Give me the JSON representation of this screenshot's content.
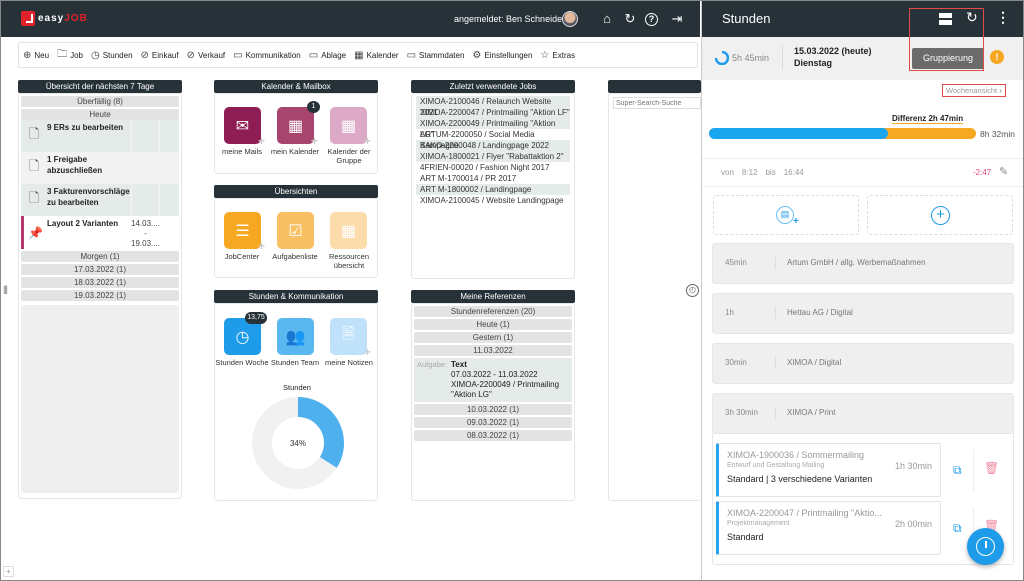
{
  "app": {
    "logo_left": "easy",
    "logo_right": "JOB",
    "logged_in": "angemeldet: Ben Schneider"
  },
  "top_icons": [
    "home-icon",
    "refresh-icon",
    "help-icon",
    "logout-icon"
  ],
  "toolbar": [
    {
      "label": "Neu",
      "icon": "⊕"
    },
    {
      "label": "Job",
      "icon": "🗀"
    },
    {
      "label": "Stunden",
      "icon": "◷"
    },
    {
      "label": "Einkauf",
      "icon": "⊘"
    },
    {
      "label": "Verkauf",
      "icon": "⊘"
    },
    {
      "label": "Kommunikation",
      "icon": "▭"
    },
    {
      "label": "Ablage",
      "icon": "▭"
    },
    {
      "label": "Kalender",
      "icon": "▦"
    },
    {
      "label": "Stammdaten",
      "icon": "▭"
    },
    {
      "label": "Einstellungen",
      "icon": "⚙"
    },
    {
      "label": "Extras",
      "icon": "☆"
    }
  ],
  "overview": {
    "title": "Übersicht der nächsten 7 Tage",
    "overdue": "Überfällig (8)",
    "today": "Heute",
    "tasks": [
      {
        "label": "9 ERs zu bearbeiten"
      },
      {
        "label": "1 Freigabe abzuschließen"
      },
      {
        "label": "3 Fakturenvorschläge zu bearbeiten"
      }
    ],
    "pinned": {
      "label": "Layout 2 Varianten",
      "from": "14.03....",
      "dash": "-",
      "to": "19.03...."
    },
    "days": [
      "Morgen (1)",
      "17.03.2022 (1)",
      "18.03.2022 (1)",
      "19.03.2022 (1)"
    ]
  },
  "calendar_mailbox": {
    "title": "Kalender & Mailbox",
    "tiles": [
      {
        "label": "meine Mails",
        "color": "#8e1d54"
      },
      {
        "label": "mein Kalender",
        "color": "#a8456f",
        "badge": "1"
      },
      {
        "label": "Kalender der Gruppe",
        "color": "#dcaac7"
      }
    ]
  },
  "overviews": {
    "title": "Übersichten",
    "tiles": [
      {
        "label": "JobCenter",
        "color": "#f7a823"
      },
      {
        "label": "Aufgabenliste",
        "color": "#f9c063"
      },
      {
        "label": "Ressourcen übersicht",
        "color": "#fbdcaa"
      }
    ]
  },
  "hours_comm": {
    "title": "Stunden & Kommunikation",
    "tiles": [
      {
        "label": "Stunden Woche",
        "color": "#1e9be9",
        "badge": "13,75"
      },
      {
        "label": "Stunden Team",
        "color": "#5ab7f0"
      },
      {
        "label": "meine Notizen",
        "color": "#bfe2fa"
      }
    ],
    "chart_title": "Stunden",
    "chart_percent": 34,
    "chart_label": "34%"
  },
  "recent_jobs": {
    "title": "Zuletzt verwendete Jobs",
    "items": [
      "XIMOA-2100046 / Relaunch Website 2021",
      "XIMOA-2200047 / Printmailing \"Aktion LF\"",
      "XIMOA-2200049 / Printmailing \"Aktion LG\"",
      "ARTUM-2200050 / Social Media Kampagne",
      "BAKO-2200048 / Landingpage 2022",
      "XIMOA-1800021 / Flyer \"Rabattaktion 2\"",
      "4FRIEN-00020 / Fashion Night 2017",
      "ART M-1700014 / PR 2017",
      "ART M-1800002 / Landingpage",
      "XIMOA-2100045 / Website Landingpage"
    ]
  },
  "references": {
    "title": "Meine Referenzen",
    "header": "Stundenreferenzen (20)",
    "groups_top": [
      "Heute (1)",
      "Gestern (1)",
      "11.03.2022"
    ],
    "task_prefix": "Aufgabe:",
    "task_title": "Text",
    "task_dates": "07.03.2022 - 11.03.2022",
    "task_job": "XIMOA-2200049 / Printmailing \"Aktion LG\"",
    "groups_bottom": [
      "10.03.2022 (1)",
      "09.03.2022 (1)",
      "08.03.2022 (1)"
    ]
  },
  "search": {
    "placeholder": "Super-Search-Suche"
  },
  "hours_panel": {
    "title": "Stunden",
    "logged": "5h 45min",
    "date": "15.03.2022 (heute)",
    "weekday": "Dienstag",
    "grouping_button": "Gruppierung",
    "week_view_link": "Wochenansicht",
    "difference": "Differenz 2h 47min",
    "target": "8h 32min",
    "progress_fraction": 0.67,
    "von_label": "von",
    "von": "8:12",
    "bis_label": "bis",
    "bis": "16:44",
    "delta": "-2:47",
    "groups": [
      {
        "duration": "45min",
        "name": "Artum GmbH / allg. Werbemaßnahmen"
      },
      {
        "duration": "1h",
        "name": "Hettau AG / Digital"
      },
      {
        "duration": "30min",
        "name": "XIMOA / Digital"
      },
      {
        "duration": "3h 30min",
        "name": "XIMOA / Print"
      }
    ],
    "entries": [
      {
        "job": "XIMOA-1900036 / Sommermailing",
        "activity": "Entwurf und Gestaltung Mailing",
        "text": "Standard | 3 verschiedene Varianten",
        "duration": "1h 30min"
      },
      {
        "job": "XIMOA-2200047 / Printmailing \"Aktio...",
        "activity": "Projektmanagement",
        "text": "Standard",
        "duration": "2h 00min"
      }
    ]
  },
  "colors": {
    "accent_blue": "#1e9be9",
    "accent_orange": "#f7a823",
    "dark": "#263238",
    "delta_red": "#e0457b"
  }
}
